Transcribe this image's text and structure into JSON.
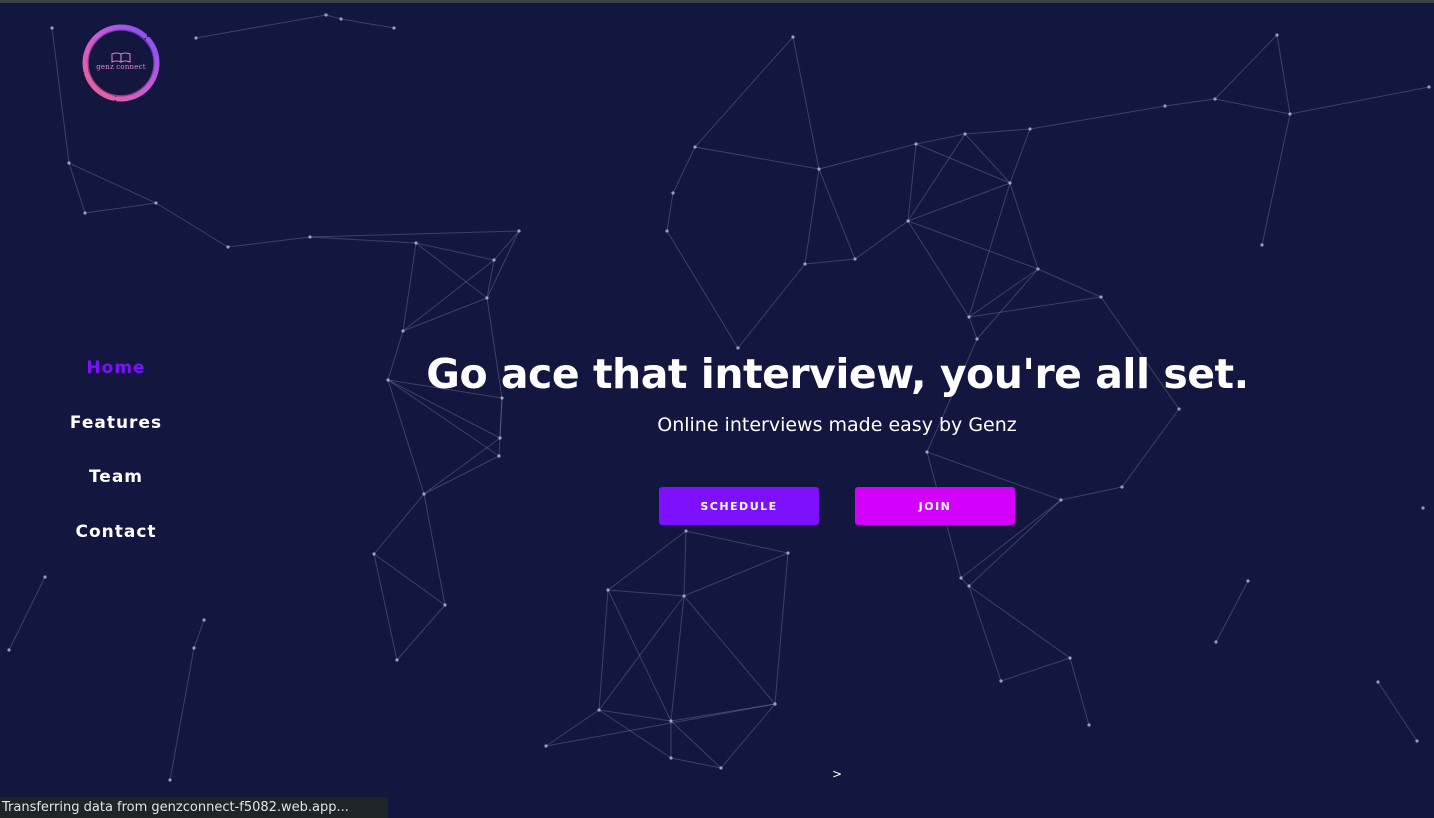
{
  "brand": {
    "logo_text": "genz connect",
    "logo_ring_colors": [
      "#f06292",
      "#a64dff",
      "#7c4dff"
    ]
  },
  "nav": {
    "items": [
      {
        "label": "Home",
        "active": true
      },
      {
        "label": "Features",
        "active": false
      },
      {
        "label": "Team",
        "active": false
      },
      {
        "label": "Contact",
        "active": false
      }
    ]
  },
  "hero": {
    "title": "Go ace that interview, you're all set.",
    "subtitle": "Online interviews made easy by Genz",
    "schedule_label": "SCHEDULE",
    "join_label": "JOIN"
  },
  "scroll_indicator": ">",
  "status_bar": {
    "text": "Transferring data from genzconnect-f5082.web.app..."
  },
  "colors": {
    "background": "#13163e",
    "nav_active": "#7d10ff",
    "schedule_button": "#7d10ff",
    "join_button": "#d400fd",
    "network_lines": "#8a8fb8"
  }
}
